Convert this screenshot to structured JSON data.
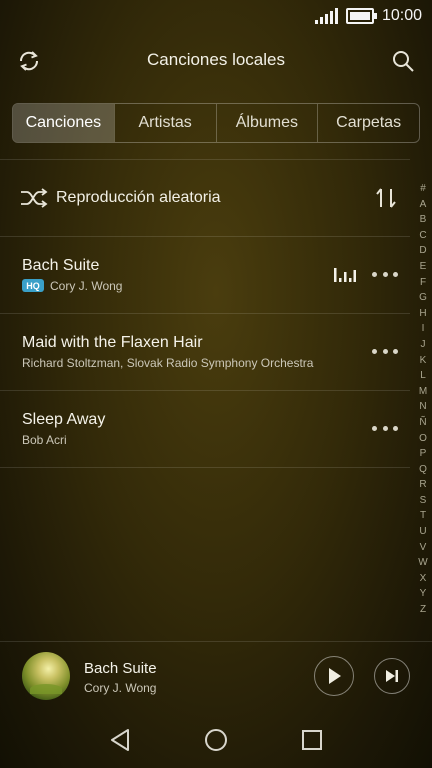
{
  "status_bar": {
    "time": "10:00"
  },
  "header": {
    "title": "Canciones locales"
  },
  "tabs": [
    {
      "label": "Canciones",
      "active": true
    },
    {
      "label": "Artistas",
      "active": false
    },
    {
      "label": "Álbumes",
      "active": false
    },
    {
      "label": "Carpetas",
      "active": false
    }
  ],
  "shuffle": {
    "label": "Reproducción aleatoria"
  },
  "songs": [
    {
      "title": "Bach Suite",
      "artist": "Cory J. Wong",
      "badge": "HQ",
      "playing": true
    },
    {
      "title": "Maid with the Flaxen Hair",
      "artist": "Richard Stoltzman, Slovak Radio Symphony Orchestra"
    },
    {
      "title": "Sleep Away",
      "artist": "Bob Acri"
    }
  ],
  "alphabet": [
    "#",
    "A",
    "B",
    "C",
    "D",
    "E",
    "F",
    "G",
    "H",
    "I",
    "J",
    "K",
    "L",
    "M",
    "N",
    "Ñ",
    "O",
    "P",
    "Q",
    "R",
    "S",
    "T",
    "U",
    "V",
    "W",
    "X",
    "Y",
    "Z"
  ],
  "now_playing": {
    "title": "Bach Suite",
    "artist": "Cory J. Wong"
  },
  "colors": {
    "badge": "#3aa0c8",
    "active_tab_bg": "rgba(255,255,255,0.22)"
  },
  "icons": {
    "refresh": "refresh-icon",
    "search": "search-icon",
    "shuffle": "shuffle-icon",
    "sort": "sort-icon",
    "more": "more-icon",
    "equalizer": "equalizer-icon",
    "play": "play-icon",
    "next": "next-icon",
    "back": "back-icon",
    "home": "home-icon",
    "recents": "recents-icon"
  }
}
